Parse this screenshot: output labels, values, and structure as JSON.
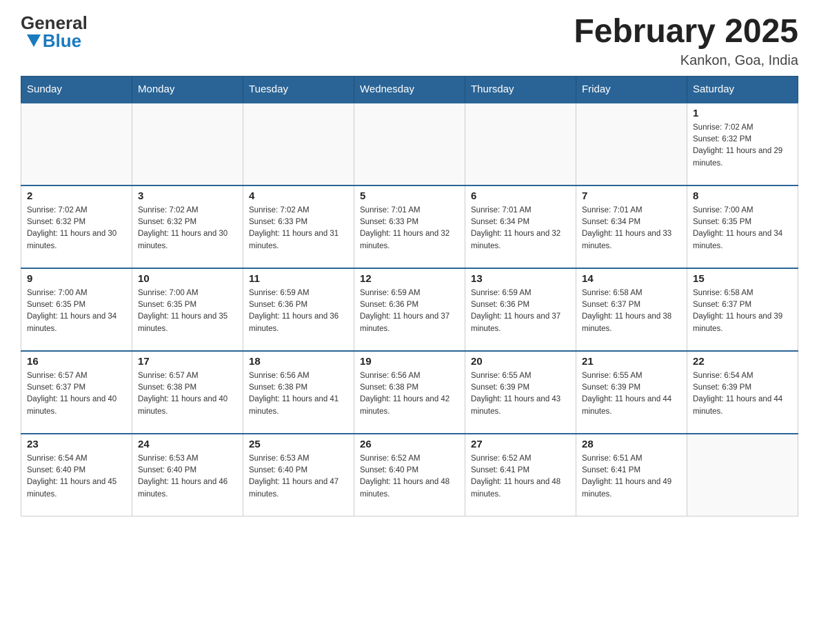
{
  "header": {
    "logo_line1": "General",
    "logo_line2": "Blue",
    "title": "February 2025",
    "subtitle": "Kankon, Goa, India"
  },
  "days_of_week": [
    "Sunday",
    "Monday",
    "Tuesday",
    "Wednesday",
    "Thursday",
    "Friday",
    "Saturday"
  ],
  "weeks": [
    [
      {
        "day": "",
        "sunrise": "",
        "sunset": "",
        "daylight": ""
      },
      {
        "day": "",
        "sunrise": "",
        "sunset": "",
        "daylight": ""
      },
      {
        "day": "",
        "sunrise": "",
        "sunset": "",
        "daylight": ""
      },
      {
        "day": "",
        "sunrise": "",
        "sunset": "",
        "daylight": ""
      },
      {
        "day": "",
        "sunrise": "",
        "sunset": "",
        "daylight": ""
      },
      {
        "day": "",
        "sunrise": "",
        "sunset": "",
        "daylight": ""
      },
      {
        "day": "1",
        "sunrise": "Sunrise: 7:02 AM",
        "sunset": "Sunset: 6:32 PM",
        "daylight": "Daylight: 11 hours and 29 minutes."
      }
    ],
    [
      {
        "day": "2",
        "sunrise": "Sunrise: 7:02 AM",
        "sunset": "Sunset: 6:32 PM",
        "daylight": "Daylight: 11 hours and 30 minutes."
      },
      {
        "day": "3",
        "sunrise": "Sunrise: 7:02 AM",
        "sunset": "Sunset: 6:32 PM",
        "daylight": "Daylight: 11 hours and 30 minutes."
      },
      {
        "day": "4",
        "sunrise": "Sunrise: 7:02 AM",
        "sunset": "Sunset: 6:33 PM",
        "daylight": "Daylight: 11 hours and 31 minutes."
      },
      {
        "day": "5",
        "sunrise": "Sunrise: 7:01 AM",
        "sunset": "Sunset: 6:33 PM",
        "daylight": "Daylight: 11 hours and 32 minutes."
      },
      {
        "day": "6",
        "sunrise": "Sunrise: 7:01 AM",
        "sunset": "Sunset: 6:34 PM",
        "daylight": "Daylight: 11 hours and 32 minutes."
      },
      {
        "day": "7",
        "sunrise": "Sunrise: 7:01 AM",
        "sunset": "Sunset: 6:34 PM",
        "daylight": "Daylight: 11 hours and 33 minutes."
      },
      {
        "day": "8",
        "sunrise": "Sunrise: 7:00 AM",
        "sunset": "Sunset: 6:35 PM",
        "daylight": "Daylight: 11 hours and 34 minutes."
      }
    ],
    [
      {
        "day": "9",
        "sunrise": "Sunrise: 7:00 AM",
        "sunset": "Sunset: 6:35 PM",
        "daylight": "Daylight: 11 hours and 34 minutes."
      },
      {
        "day": "10",
        "sunrise": "Sunrise: 7:00 AM",
        "sunset": "Sunset: 6:35 PM",
        "daylight": "Daylight: 11 hours and 35 minutes."
      },
      {
        "day": "11",
        "sunrise": "Sunrise: 6:59 AM",
        "sunset": "Sunset: 6:36 PM",
        "daylight": "Daylight: 11 hours and 36 minutes."
      },
      {
        "day": "12",
        "sunrise": "Sunrise: 6:59 AM",
        "sunset": "Sunset: 6:36 PM",
        "daylight": "Daylight: 11 hours and 37 minutes."
      },
      {
        "day": "13",
        "sunrise": "Sunrise: 6:59 AM",
        "sunset": "Sunset: 6:36 PM",
        "daylight": "Daylight: 11 hours and 37 minutes."
      },
      {
        "day": "14",
        "sunrise": "Sunrise: 6:58 AM",
        "sunset": "Sunset: 6:37 PM",
        "daylight": "Daylight: 11 hours and 38 minutes."
      },
      {
        "day": "15",
        "sunrise": "Sunrise: 6:58 AM",
        "sunset": "Sunset: 6:37 PM",
        "daylight": "Daylight: 11 hours and 39 minutes."
      }
    ],
    [
      {
        "day": "16",
        "sunrise": "Sunrise: 6:57 AM",
        "sunset": "Sunset: 6:37 PM",
        "daylight": "Daylight: 11 hours and 40 minutes."
      },
      {
        "day": "17",
        "sunrise": "Sunrise: 6:57 AM",
        "sunset": "Sunset: 6:38 PM",
        "daylight": "Daylight: 11 hours and 40 minutes."
      },
      {
        "day": "18",
        "sunrise": "Sunrise: 6:56 AM",
        "sunset": "Sunset: 6:38 PM",
        "daylight": "Daylight: 11 hours and 41 minutes."
      },
      {
        "day": "19",
        "sunrise": "Sunrise: 6:56 AM",
        "sunset": "Sunset: 6:38 PM",
        "daylight": "Daylight: 11 hours and 42 minutes."
      },
      {
        "day": "20",
        "sunrise": "Sunrise: 6:55 AM",
        "sunset": "Sunset: 6:39 PM",
        "daylight": "Daylight: 11 hours and 43 minutes."
      },
      {
        "day": "21",
        "sunrise": "Sunrise: 6:55 AM",
        "sunset": "Sunset: 6:39 PM",
        "daylight": "Daylight: 11 hours and 44 minutes."
      },
      {
        "day": "22",
        "sunrise": "Sunrise: 6:54 AM",
        "sunset": "Sunset: 6:39 PM",
        "daylight": "Daylight: 11 hours and 44 minutes."
      }
    ],
    [
      {
        "day": "23",
        "sunrise": "Sunrise: 6:54 AM",
        "sunset": "Sunset: 6:40 PM",
        "daylight": "Daylight: 11 hours and 45 minutes."
      },
      {
        "day": "24",
        "sunrise": "Sunrise: 6:53 AM",
        "sunset": "Sunset: 6:40 PM",
        "daylight": "Daylight: 11 hours and 46 minutes."
      },
      {
        "day": "25",
        "sunrise": "Sunrise: 6:53 AM",
        "sunset": "Sunset: 6:40 PM",
        "daylight": "Daylight: 11 hours and 47 minutes."
      },
      {
        "day": "26",
        "sunrise": "Sunrise: 6:52 AM",
        "sunset": "Sunset: 6:40 PM",
        "daylight": "Daylight: 11 hours and 48 minutes."
      },
      {
        "day": "27",
        "sunrise": "Sunrise: 6:52 AM",
        "sunset": "Sunset: 6:41 PM",
        "daylight": "Daylight: 11 hours and 48 minutes."
      },
      {
        "day": "28",
        "sunrise": "Sunrise: 6:51 AM",
        "sunset": "Sunset: 6:41 PM",
        "daylight": "Daylight: 11 hours and 49 minutes."
      },
      {
        "day": "",
        "sunrise": "",
        "sunset": "",
        "daylight": ""
      }
    ]
  ]
}
